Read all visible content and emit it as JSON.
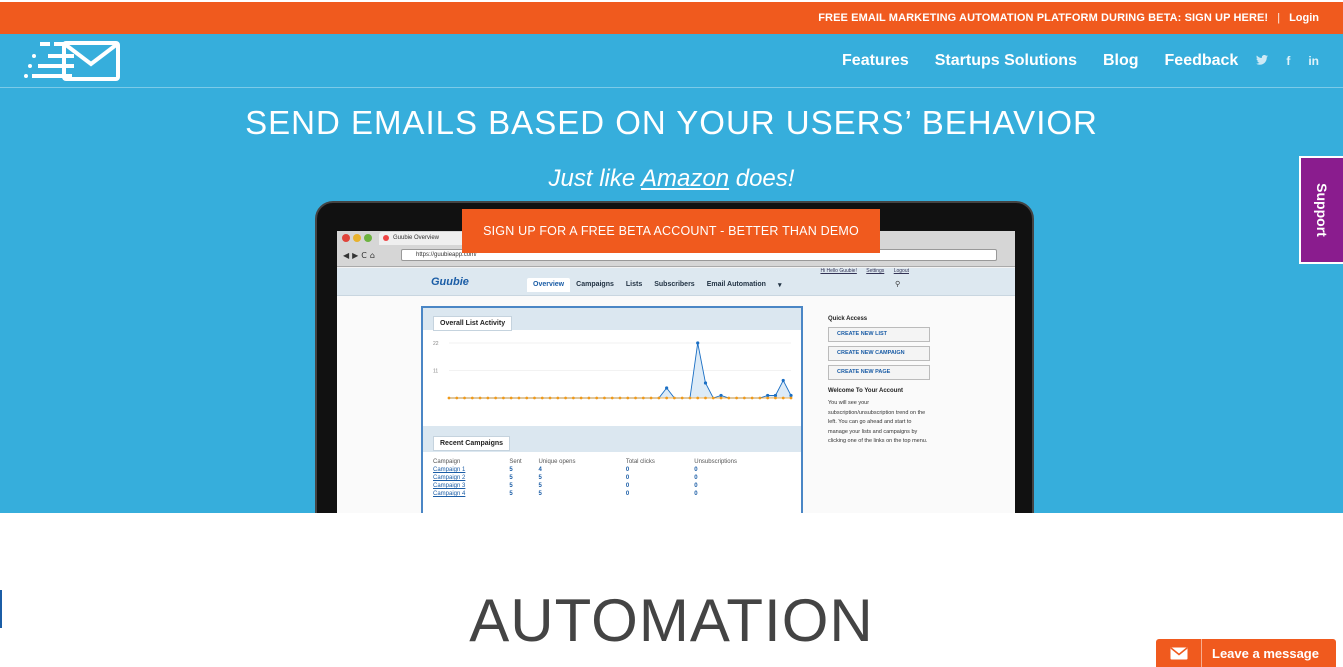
{
  "topbar": {
    "promo": "FREE EMAIL MARKETING AUTOMATION PLATFORM DURING BETA: SIGN UP HERE!",
    "separator": "|",
    "login": "Login"
  },
  "nav": {
    "logo_icon": "envelope-speed-icon",
    "items": [
      "Features",
      "Startups Solutions",
      "Blog",
      "Feedback"
    ],
    "social": [
      {
        "name": "twitter-icon",
        "glyph": "t"
      },
      {
        "name": "facebook-icon",
        "glyph": "f"
      },
      {
        "name": "linkedin-icon",
        "glyph": "in"
      }
    ]
  },
  "hero": {
    "headline": "SEND EMAILS BASED ON YOUR USERS’ BEHAVIOR",
    "sub_prefix": "Just like ",
    "sub_link": "Amazon",
    "sub_suffix": " does!",
    "cta": "SIGN UP FOR A FREE BETA ACCOUNT - BETTER THAN DEMO"
  },
  "browser": {
    "tab_title": "Guubie Overview",
    "nav_glyphs": "◀▶C⌂",
    "url": "https://guubieapp.com/"
  },
  "app": {
    "brand": "Guubie",
    "top_links": [
      "Hi Hello Guubie!",
      "Settings",
      "Logout"
    ],
    "tabs": [
      "Overview",
      "Campaigns",
      "Lists",
      "Subscribers",
      "Email Automation",
      "▾"
    ],
    "active_tab": "Overview",
    "activity_title": "Overall List Activity",
    "recent_title": "Recent Campaigns",
    "table": {
      "headers": [
        "Campaign",
        "Sent",
        "Unique opens",
        "Total clicks",
        "Unsubscriptions"
      ],
      "rows": [
        [
          "Campaign 1",
          "5",
          "4",
          "0",
          "0"
        ],
        [
          "Campaign 2",
          "5",
          "5",
          "0",
          "0"
        ],
        [
          "Campaign 3",
          "5",
          "5",
          "0",
          "0"
        ],
        [
          "Campaign 4",
          "5",
          "5",
          "0",
          "0"
        ]
      ]
    },
    "quick_access": {
      "title": "Quick Access",
      "buttons": [
        "CREATE NEW LIST",
        "CREATE NEW CAMPAIGN",
        "CREATE NEW PAGE"
      ]
    },
    "welcome": {
      "title": "Welcome To Your Account",
      "text": "You will see your subscription/unsubscription trend on the left. You can go ahead and start to manage your lists and campaigns by clicking one of the links on the top menu."
    }
  },
  "chart_data": {
    "type": "line",
    "yticks": [
      "22",
      "11"
    ],
    "ylim": [
      0,
      24
    ],
    "series": [
      {
        "color": "#1b6fc4",
        "values": [
          0,
          0,
          0,
          0,
          0,
          0,
          0,
          0,
          0,
          0,
          0,
          0,
          0,
          0,
          0,
          0,
          0,
          0,
          0,
          0,
          0,
          0,
          0,
          0,
          0,
          0,
          0,
          0,
          4,
          0,
          0,
          0,
          22,
          6,
          0,
          1,
          0,
          0,
          0,
          0,
          0,
          1,
          1,
          7,
          1
        ]
      },
      {
        "color": "#f09a1a",
        "values": [
          0,
          0,
          0,
          0,
          0,
          0,
          0,
          0,
          0,
          0,
          0,
          0,
          0,
          0,
          0,
          0,
          0,
          0,
          0,
          0,
          0,
          0,
          0,
          0,
          0,
          0,
          0,
          0,
          0,
          0,
          0,
          0,
          0,
          0,
          0,
          0,
          0,
          0,
          0,
          0,
          0,
          0,
          0,
          0,
          0
        ]
      }
    ]
  },
  "support": {
    "label": "Support"
  },
  "section": {
    "title": "AUTOMATION"
  },
  "chat": {
    "label": "Leave a message",
    "icon": "envelope-icon"
  },
  "colors": {
    "orange": "#f05a1e",
    "blue": "#36aedc",
    "purple": "#8a1c8e"
  }
}
